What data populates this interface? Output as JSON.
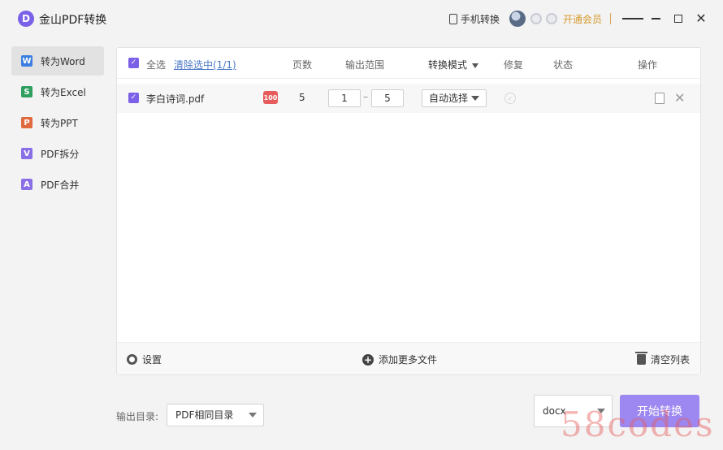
{
  "app": {
    "logo_letter": "D",
    "title": "金山PDF转换"
  },
  "titlebar": {
    "phone_convert": "手机转换",
    "vip": "开通会员",
    "icons": [
      "phone-icon",
      "avatar",
      "badge-icon",
      "menu-icon",
      "minimize-icon",
      "maximize-icon",
      "close-icon"
    ],
    "close_glyph": "✕"
  },
  "sidebar": {
    "items": [
      {
        "icon_text": "W",
        "label": "转为Word",
        "color": "#3d7fe0",
        "active": true
      },
      {
        "icon_text": "S",
        "label": "转为Excel",
        "color": "#2f9e5f"
      },
      {
        "icon_text": "P",
        "label": "转为PPT",
        "color": "#e06a3d"
      },
      {
        "icon_text": "V",
        "label": "PDF拆分",
        "color": "#8a6ee6"
      },
      {
        "icon_text": "A",
        "label": "PDF合并",
        "color": "#8a6ee6"
      }
    ]
  },
  "table": {
    "headers": {
      "select_all": "全选",
      "clear_selection": "清除选中(1/1)",
      "pages": "页数",
      "range": "输出范围",
      "mode": "转换模式",
      "repair": "修复",
      "status": "状态",
      "actions": "操作"
    },
    "rows": [
      {
        "checked": true,
        "filename": "李白诗词.pdf",
        "score_badge": "100",
        "pages": "5",
        "range_from": "1",
        "range_sep": "–",
        "range_to": "5",
        "mode": "自动选择"
      }
    ]
  },
  "footer": {
    "settings": "设置",
    "add_files": "添加更多文件",
    "clear_list": "清空列表"
  },
  "output": {
    "label": "输出目录:",
    "dir": "PDF相同目录",
    "format": "docx",
    "start": "开始转换"
  },
  "watermark": "58codes",
  "colors": {
    "accent": "#7b61e8",
    "start_button": "#9d87f0",
    "vip": "#d59a2c"
  }
}
